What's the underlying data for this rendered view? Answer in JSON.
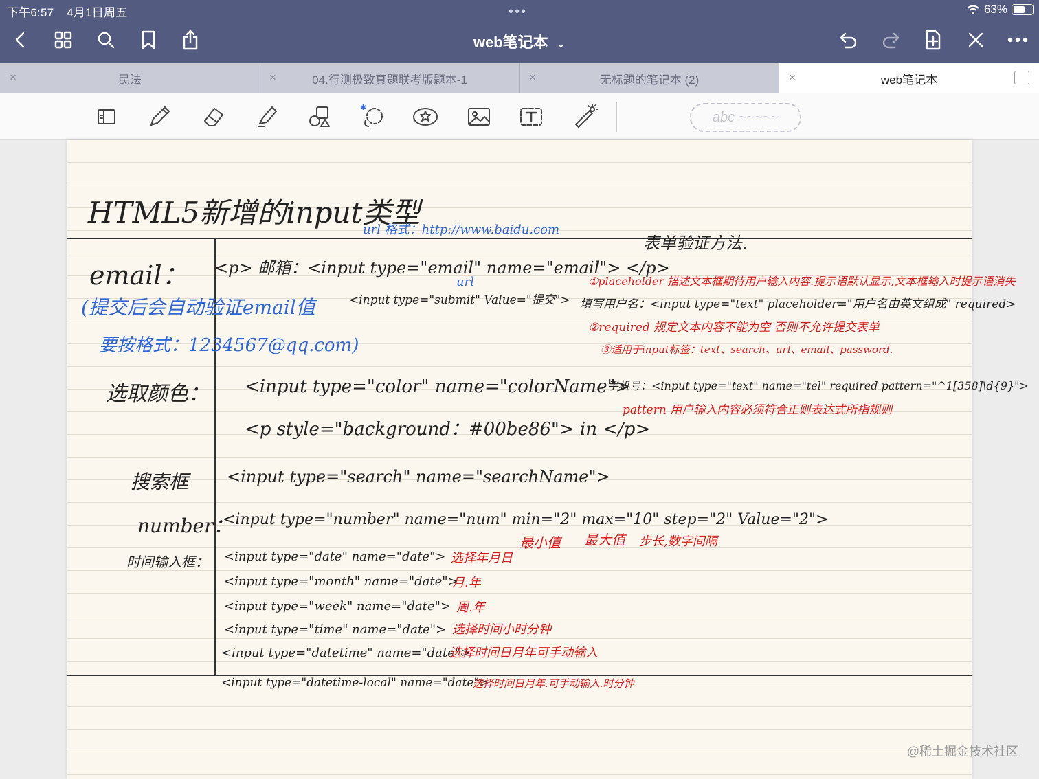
{
  "status": {
    "time": "下午6:57",
    "date": "4月1日周五",
    "battery": "63%",
    "battery_level": 0.63
  },
  "header": {
    "title": "web笔记本",
    "title_chevron": "⌄"
  },
  "tabs": [
    {
      "label": "民法",
      "active": false
    },
    {
      "label": "04.行测极致真题联考版题本-1",
      "active": false
    },
    {
      "label": "无标题的笔记本 (2)",
      "active": false
    },
    {
      "label": "web笔记本",
      "active": true
    }
  ],
  "tab_close": "×",
  "toolbar": {
    "scribble_placeholder": "abc ~~~~~"
  },
  "note": {
    "title": "HTML5新增的input类型",
    "url_note": "url 格式：http://www.baidu.com",
    "email_label": "email：",
    "email_code": "<p> 邮箱：<input type=\"email\" name=\"email\"> </p>",
    "url_word": "url",
    "submit_code": "<input type=\"submit\" Value=\"提交\">",
    "email_hint1": "(提交后会自动验证email值",
    "email_hint2": "要按格式：1234567@qq.com)",
    "color_label": "选取颜色：",
    "color_code1": "<input type=\"color\" name=\"colorName\">",
    "color_code2": "<p style=\"background：#00be86\"> in </p>",
    "search_label": "搜索框",
    "search_code": "<input type=\"search\" name=\"searchName\">",
    "number_label": "number：",
    "number_code": "<input type=\"number\" name=\"num\" min=\"2\" max=\"10\" step=\"2\" Value=\"2\">",
    "min_note": "最小值",
    "max_note": "最大值",
    "step_note": "步长,数字间隔",
    "time_label": "时间输入框：",
    "date_rows": [
      {
        "code": "<input type=\"date\" name=\"date\">",
        "note": "选择年月日"
      },
      {
        "code": "<input type=\"month\" name=\"date\">",
        "note": "月.年"
      },
      {
        "code": "<input type=\"week\" name=\"date\">",
        "note": "周.年"
      },
      {
        "code": "<input type=\"time\" name=\"date\">",
        "note": "选择时间小时分钟"
      },
      {
        "code": "<input type=\"datetime\" name=\"date\">",
        "note": "选择时间日月年可手动输入"
      },
      {
        "code": "<input type=\"datetime-local\" name=\"date\">",
        "note": "选择时间日月年.可手动输入.时分钟"
      }
    ],
    "validation_title": "表单验证方法.",
    "v1": "①placeholder 描述文本框期待用户输入内容.提示语默认显示,文本框输入时提示语消失",
    "v_fill": "填写用户名：<input type=\"text\" placeholder=\"用户名由英文组成\" required>",
    "v2": "②required 规定文本内容不能为空 否则不允许提交表单",
    "v3": "③适用于input标签：text、search、url、email、password.",
    "phone": "手机号：<input type=\"text\" name=\"tel\" required pattern=\"^1[358]\\d{9}\">",
    "pattern_note": "pattern 用户输入内容必须符合正则表达式所指规则"
  },
  "watermark": "@稀土掘金技术社区"
}
